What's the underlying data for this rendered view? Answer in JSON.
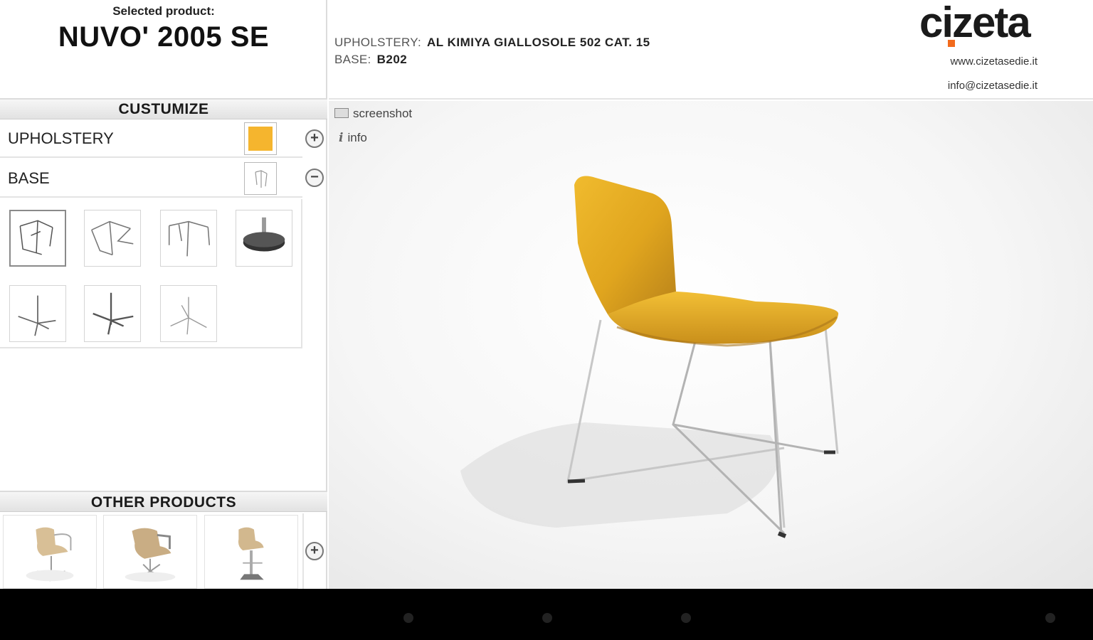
{
  "product": {
    "selected_label": "Selected product:",
    "name": "NUVO' 2005 SE"
  },
  "customize": {
    "header": "CUSTUMIZE",
    "options": [
      {
        "label": "UPHOLSTERY",
        "swatch_color": "#f5b52e",
        "toggle": "+"
      },
      {
        "label": "BASE",
        "toggle": "−"
      }
    ],
    "base_variants": [
      {
        "icon": "sled-base-icon",
        "selected": true
      },
      {
        "icon": "sled-base-angled-icon",
        "selected": false
      },
      {
        "icon": "four-leg-base-icon",
        "selected": false
      },
      {
        "icon": "pedestal-disc-base-icon",
        "selected": false
      },
      {
        "icon": "star-base-icon",
        "selected": false
      },
      {
        "icon": "star-base-column-icon",
        "selected": false
      },
      {
        "icon": "tripod-star-base-icon",
        "selected": false
      }
    ]
  },
  "other_products": {
    "header": "OTHER PRODUCTS",
    "items": [
      {
        "icon": "armchair-swivel-icon"
      },
      {
        "icon": "lounge-chair-swivel-icon"
      },
      {
        "icon": "bar-stool-icon"
      }
    ],
    "toggle": "+"
  },
  "specs": {
    "upholstery_key": "UPHOLSTERY:",
    "upholstery_value": "AL KIMIYA GIALLOSOLE 502 CAT. 15",
    "base_key": "BASE:",
    "base_value": "B202"
  },
  "brand": {
    "logo_text": "cizeta",
    "accent_color": "#f26b1d",
    "website": "www.cizetasedie.it",
    "email": "info@cizetasedie.it"
  },
  "viewer": {
    "screenshot_label": "screenshot",
    "info_label": "info",
    "chair_color": "#e0a51e"
  }
}
